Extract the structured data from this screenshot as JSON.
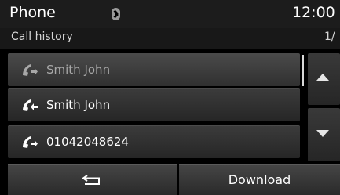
{
  "header": {
    "title": "Phone",
    "clock": "12:00",
    "bluetooth_icon": "bluetooth-icon"
  },
  "subheader": {
    "title": "Call history",
    "page": "1/"
  },
  "history": [
    {
      "name": "Smith John",
      "icon": "outgoing-call-icon",
      "selected": true
    },
    {
      "name": "Smith John",
      "icon": "incoming-call-icon",
      "selected": false
    },
    {
      "name": "01042048624",
      "icon": "outgoing-call-icon",
      "selected": false
    }
  ],
  "controls": {
    "scroll_up_icon": "triangle-up-icon",
    "scroll_down_icon": "triangle-down-icon",
    "back_icon": "back-arrow-icon",
    "download_label": "Download"
  },
  "colors": {
    "background": "#000000",
    "row": "#2e2e2e",
    "selected_text": "#a8a8a8"
  }
}
